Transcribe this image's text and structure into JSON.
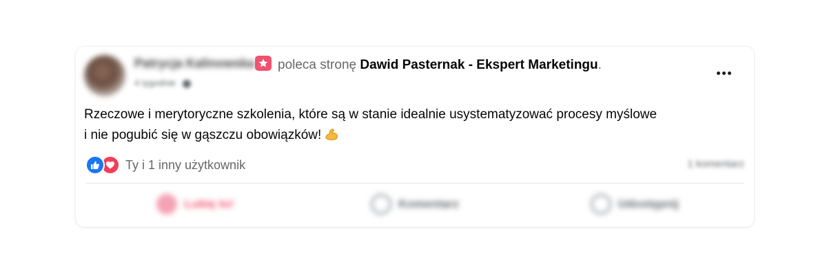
{
  "post": {
    "author_name": "Patrycja Kalinowska",
    "recommend_verb": "poleca stronę",
    "page_name": "Dawid Pasternak - Ekspert Marketingu",
    "page_name_suffix": ".",
    "meta_time": "4 tygodnie",
    "body_line1": "Rzeczowe i merytoryczne szkolenia, które są w stanie idealnie usystematyzować procesy myślowe",
    "body_line2": "i nie pogubić się w gąszczu obowiązków!",
    "emoji": "flexed-biceps-icon"
  },
  "reactions": {
    "types": [
      "like-icon",
      "love-icon"
    ],
    "text": "Ty i 1 inny użytkownik",
    "comments": "1 komentarz"
  },
  "actions": {
    "like_label": "Lubię to!",
    "comment_label": "Komentarz",
    "share_label": "Udostępnij"
  },
  "colors": {
    "like_blue": "#1877f2",
    "love_red": "#f33e58",
    "recommend_pink": "#f0536f",
    "secondary_text": "#65676b"
  }
}
